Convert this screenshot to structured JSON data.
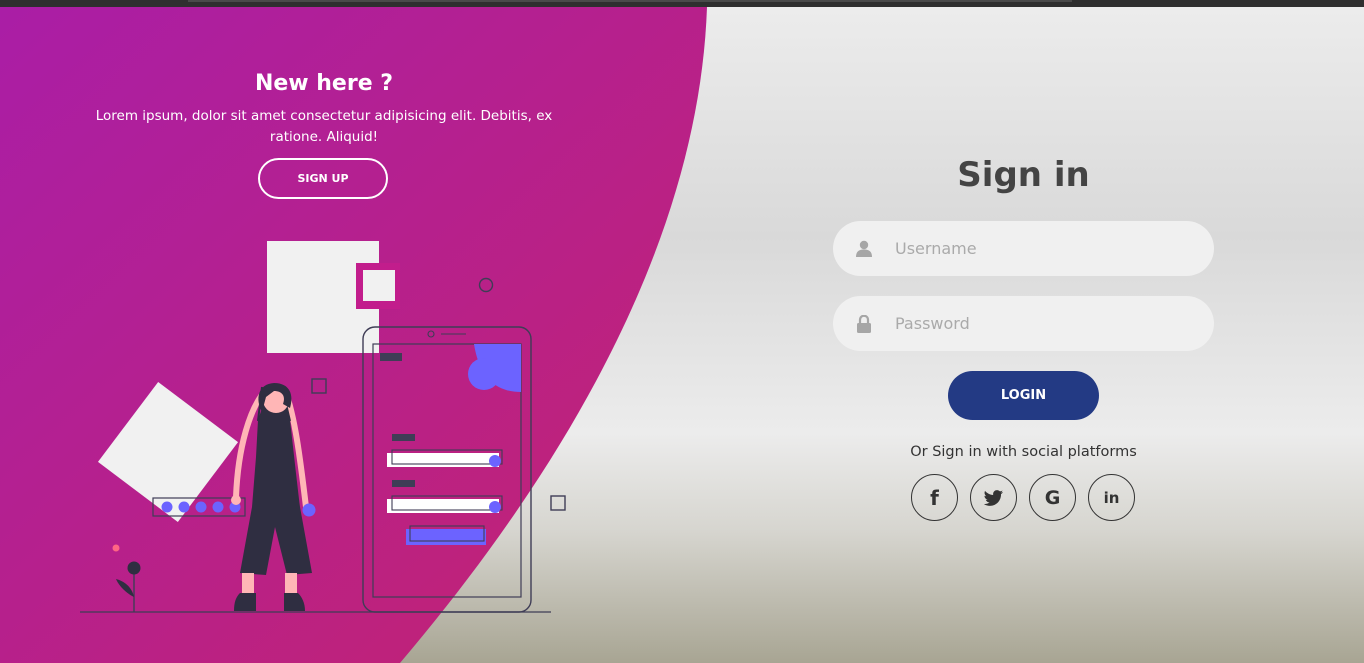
{
  "left_panel": {
    "title": "New here ?",
    "description": "Lorem ipsum, dolor sit amet consectetur adipisicing elit. Debitis, ex ratione. Aliquid!",
    "signup_label": "SIGN UP"
  },
  "signin": {
    "title": "Sign in",
    "username": {
      "placeholder": "Username",
      "value": "",
      "icon": "user-icon"
    },
    "password": {
      "placeholder": "Password",
      "value": "",
      "icon": "lock-icon"
    },
    "login_label": "LOGIN",
    "social_text": "Or Sign in with social platforms",
    "social": [
      {
        "name": "facebook",
        "glyph": "f",
        "icon": "facebook-icon"
      },
      {
        "name": "twitter",
        "glyph": "",
        "icon": "twitter-icon"
      },
      {
        "name": "google",
        "glyph": "G",
        "icon": "google-icon"
      },
      {
        "name": "linkedin",
        "glyph": "in",
        "icon": "linkedin-icon"
      }
    ]
  },
  "colors": {
    "gradient_start": "#aa1ea6",
    "gradient_end": "#c4236f",
    "login_button": "#233a84",
    "accent_purple": "#6c63ff",
    "heading_gray": "#444444"
  }
}
